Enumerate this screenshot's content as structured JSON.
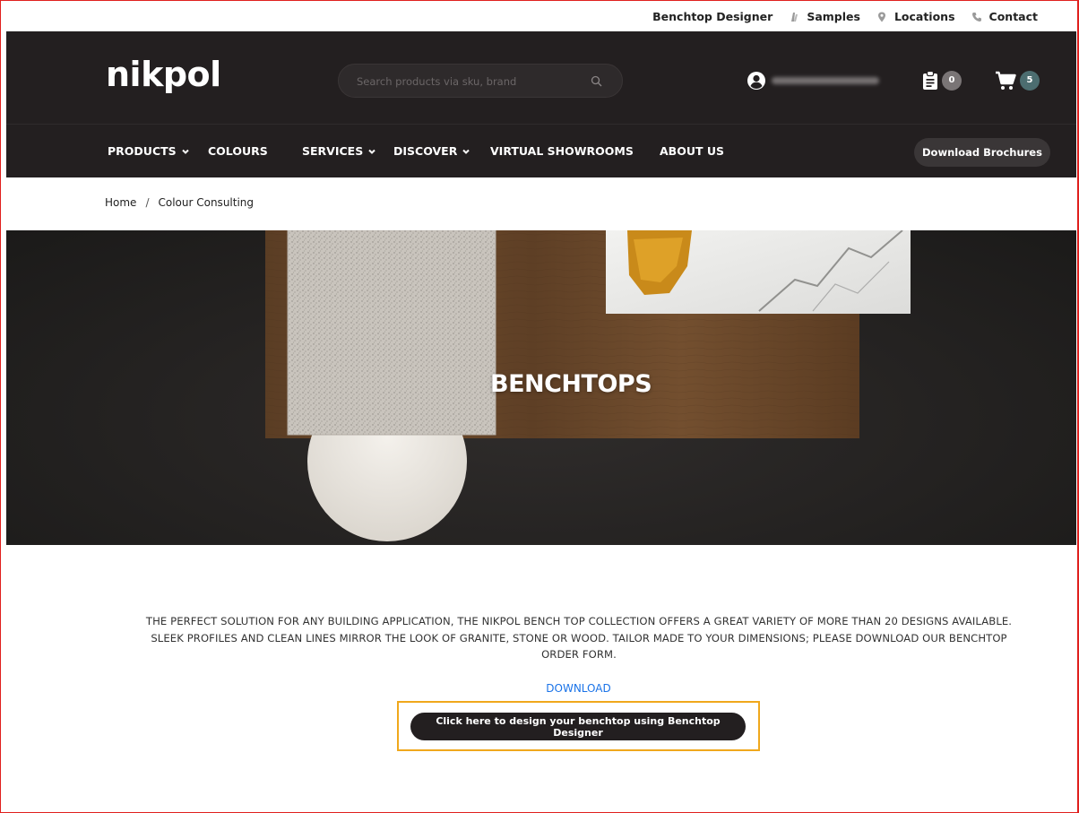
{
  "utility": {
    "links": [
      {
        "label": "Benchtop Designer",
        "icon": ""
      },
      {
        "label": "Samples",
        "icon": "samples-icon"
      },
      {
        "label": "Locations",
        "icon": "map-pin-icon"
      },
      {
        "label": "Contact",
        "icon": "phone-icon"
      }
    ]
  },
  "header": {
    "logo": "nikpol",
    "search_placeholder": "Search products via sku, brand",
    "quote_count": "0",
    "cart_count": "5"
  },
  "nav": {
    "items": [
      {
        "label": "PRODUCTS",
        "dropdown": true
      },
      {
        "label": "COLOURS",
        "dropdown": false
      },
      {
        "label": "SERVICES",
        "dropdown": true
      },
      {
        "label": "DISCOVER",
        "dropdown": true
      },
      {
        "label": "VIRTUAL SHOWROOMS",
        "dropdown": false
      },
      {
        "label": "ABOUT US",
        "dropdown": false
      }
    ],
    "brochure_button": "Download Brochures"
  },
  "breadcrumb": {
    "home": "Home",
    "separator": "/",
    "current": "Colour Consulting"
  },
  "hero": {
    "title": "BENCHTOPS"
  },
  "content": {
    "description_line1": "THE PERFECT SOLUTION FOR ANY BUILDING APPLICATION, THE NIKPOL BENCH TOP COLLECTION OFFERS A GREAT VARIETY OF MORE THAN 20 DESIGNS AVAILABLE.",
    "description_line2": "SLEEK PROFILES AND CLEAN LINES MIRROR THE LOOK OF GRANITE, STONE OR WOOD. TAILOR MADE TO YOUR DIMENSIONS; PLEASE DOWNLOAD OUR BENCHTOP",
    "description_line3": "ORDER FORM.",
    "download_link": "DOWNLOAD",
    "cta_button": "Click here to design your benchtop using Benchtop Designer"
  },
  "colors": {
    "header_bg": "#231f20",
    "link_blue": "#1a73e8",
    "highlight": "#f0a81c",
    "frame": "#e0201e"
  }
}
